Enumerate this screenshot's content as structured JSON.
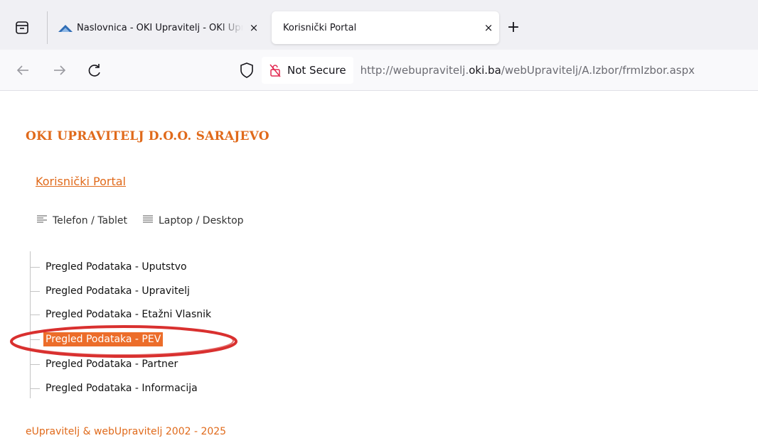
{
  "browser": {
    "tabs": [
      {
        "title": "Naslovnica - OKI Upravitelj - OKI Upravitelj",
        "close": "×"
      },
      {
        "title": "Korisnički Portal",
        "close": "×"
      }
    ],
    "new_tab": "+",
    "security_label": "Not Secure",
    "url_prefix": "http://webupravitelj.",
    "url_domain": "oki.ba",
    "url_path": "/webUpravitelj/A.Izbor/frmIzbor.aspx"
  },
  "page": {
    "company": "OKI UPRAVITELJ D.O.O. SARAJEVO",
    "portal_link": "Korisnički Portal",
    "modes": [
      {
        "label": "Telefon / Tablet",
        "icon": "text-align-left-icon"
      },
      {
        "label": "Laptop / Desktop",
        "icon": "text-justify-icon"
      }
    ],
    "menu": [
      {
        "label": "Pregled Podataka - Uputstvo"
      },
      {
        "label": "Pregled Podataka - Upravitelj"
      },
      {
        "label": "Pregled Podataka - Etažni Vlasnik"
      },
      {
        "label": "Pregled Podataka - PEV",
        "selected": true
      },
      {
        "label": "Pregled Podataka - Partner"
      },
      {
        "label": "Pregled Podataka - Informacija"
      }
    ],
    "footer": "eUpravitelj & webUpravitelj 2002 - 2025"
  },
  "colors": {
    "brand_orange": "#e06a1b",
    "selected_bg": "#ec6d2a",
    "annotation_red": "#d9302f"
  }
}
